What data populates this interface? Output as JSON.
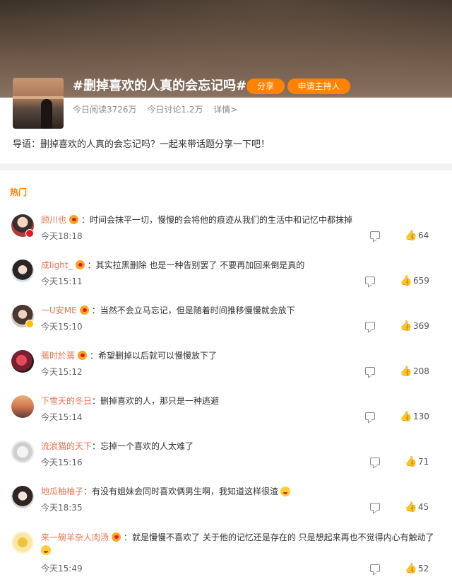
{
  "topic": {
    "title": "#删掉喜欢的人真的会忘记吗#",
    "share_label": "分享",
    "host_label": "申请主持人",
    "reads": "今日阅读3726万",
    "discussions": "今日讨论1.2万",
    "details": "详情>",
    "intro": "导语：删掉喜欢的人真的会忘记吗？一起来带话题分享一下吧！"
  },
  "section_label": "热门",
  "colors": {
    "accent": "#ff8200",
    "username": "#eb7350"
  },
  "comments": [
    {
      "user": "顾川也",
      "text": "：时间会抹平一切，慢慢的会将他的痕迹从我们的生活中和记忆中都抹掉",
      "time": "今天18:18",
      "likes": "64"
    },
    {
      "user": "成light_",
      "text": "：其实拉黑删除 也是一种告别罢了 不要再加回来倒是真的",
      "time": "今天15:11",
      "likes": "659"
    },
    {
      "user": "一U安ME",
      "text": "：当然不会立马忘记，但是随着时间推移慢慢就会放下",
      "time": "今天15:10",
      "likes": "369"
    },
    {
      "user": "蔫时於蔫",
      "text": "：希望删掉以后就可以慢慢放下了",
      "time": "今天15:12",
      "likes": "208"
    },
    {
      "user": "下雪天的冬日",
      "text": "：删掉喜欢的人，那只是一种逃避",
      "time": "今天15:14",
      "likes": "130"
    },
    {
      "user": "流浪猫的天下",
      "text": "：忘掉一个喜欢的人太难了",
      "time": "今天15:16",
      "likes": "71"
    },
    {
      "user": "地瓜柚柚子",
      "text": "：有没有姐妹会同时喜欢俩男生啊，我知道这样很渣",
      "time": "今天18:35",
      "likes": "45"
    },
    {
      "user": "来一碗羊杂人肉汤",
      "text": "：就是慢慢不喜欢了 关于他的记忆还是存在的 只是想起来再也不觉得内心有触动了",
      "time": "今天15:49",
      "likes": "52"
    }
  ]
}
